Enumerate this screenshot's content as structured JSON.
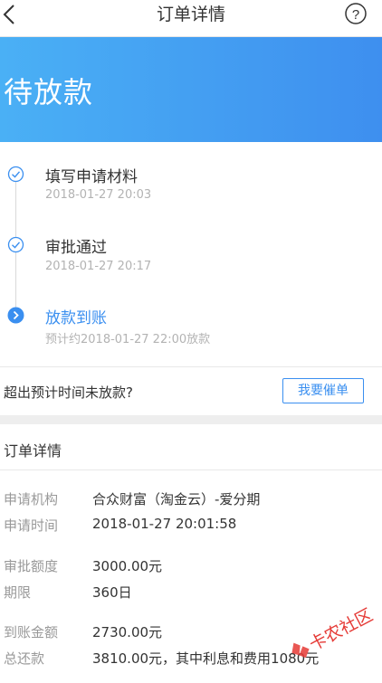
{
  "nav": {
    "title": "订单详情",
    "back_icon": "chevron-left-icon",
    "help_icon": "question-circle-icon"
  },
  "banner": {
    "status": "待放款",
    "gradient": [
      "#4ab0f5",
      "#3e8fef"
    ]
  },
  "timeline": {
    "steps": [
      {
        "name": "填写申请材料",
        "time": "2018-01-27 20:03",
        "state": "done"
      },
      {
        "name": "审批通过",
        "time": "2018-01-27 20:17",
        "state": "done"
      },
      {
        "name": "放款到账",
        "time": "预计约2018-01-27 22:00放款",
        "state": "current"
      }
    ]
  },
  "urge": {
    "question": "超出预计时间未放款?",
    "button": "我要催单"
  },
  "details": {
    "title": "订单详情",
    "rows": [
      {
        "label": "申请机构",
        "value": "合众财富（淘金云）-爱分期"
      },
      {
        "label": "申请时间",
        "value": "2018-01-27 20:01:58"
      },
      {
        "label": "审批额度",
        "value": "3000.00元"
      },
      {
        "label": "期限",
        "value": "360日"
      },
      {
        "label": "到账金额",
        "value": "2730.00元"
      },
      {
        "label": "总还款",
        "value": "3810.00元，其中利息和费用1080元"
      }
    ]
  },
  "watermark": {
    "text": "卡农社区"
  },
  "colors": {
    "accent": "#3a8ff0",
    "muted": "#999999",
    "text": "#333333"
  }
}
